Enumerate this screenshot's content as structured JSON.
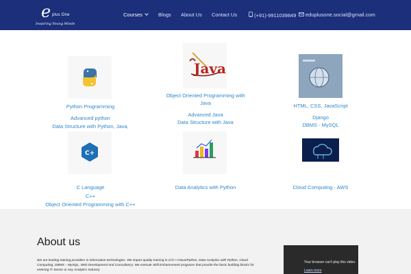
{
  "brand": {
    "logo_letter": "e",
    "logo_plus": "plus One",
    "tagline": "Inspiring Young Minds"
  },
  "nav": {
    "courses": "Courses",
    "blogs": "Blogs",
    "about": "About Us",
    "contact": "Contact Us",
    "phone": "(+91)-9911039849",
    "email": "eduplusone.social@gmail.com"
  },
  "courses": {
    "c1": {
      "title": "Python Programming",
      "items": [
        "Advanced python",
        "Data Structure with Python, Java,"
      ]
    },
    "c2": {
      "title_line1": "Object Oriented Programming with",
      "title_line2": "Java",
      "items": [
        "Advanced Java",
        "Data Structure with Java"
      ]
    },
    "c3": {
      "title": "HTML, CSS, JavaScript",
      "items": [
        "Django",
        "DBMS - MySQL"
      ]
    },
    "c4": {
      "title": "C Language",
      "items": [
        "C++",
        "Object Oriented Programming with C++"
      ]
    },
    "c5": {
      "title": "Data Analytics with Python"
    },
    "c6": {
      "title": "Cloud Computing - AWS"
    }
  },
  "about": {
    "heading": "About us",
    "paragraph": "We are leading training providers in information technologies. We impart quality training in C/C++/Java/Python, Data Analytics with Python, Cloud Computing, DBMS – MySQL, Web Development and Consultancy.  We execute Skill Enhancement programs that provide the basic building blocks for entering IT Sector or any Analytics Industry."
  },
  "video": {
    "message": "Your browser can't play this video.",
    "link": "Learn more"
  },
  "colors": {
    "header_bg": "#1b2f7a",
    "link_blue": "#2f86c9",
    "footer_bg": "#f2f2f2"
  },
  "icons": {
    "python": "python-logo-icon",
    "java": "java-logo-icon",
    "web": "web-globe-icon",
    "cpp": "cpp-logo-icon",
    "analytics": "bar-chart-icon",
    "cloud": "cloud-icon",
    "phone": "phone-icon",
    "mail": "mail-icon"
  }
}
